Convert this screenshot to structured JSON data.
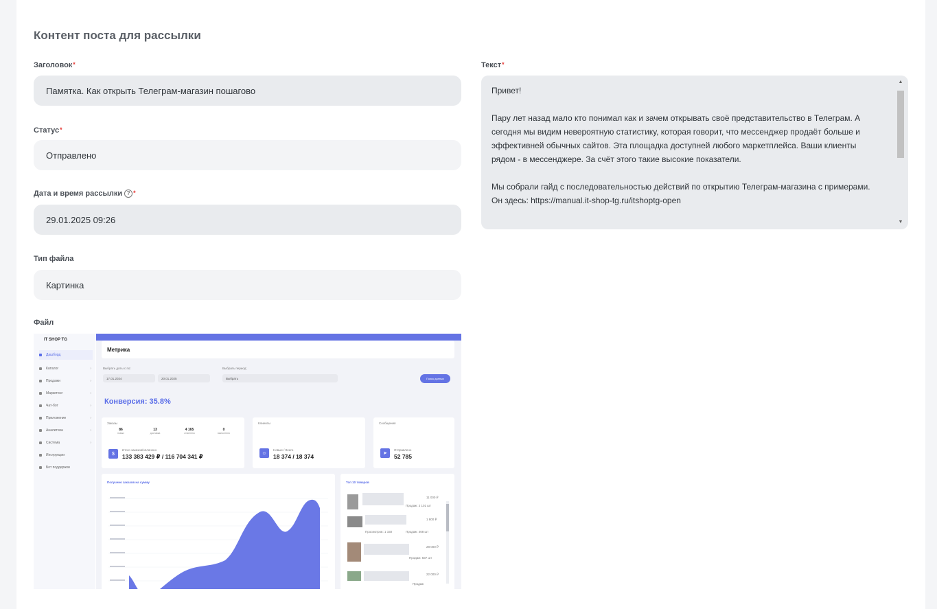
{
  "section_title": "Контент поста для рассылки",
  "fields": {
    "title": {
      "label": "Заголовок",
      "required": "*",
      "value": "Памятка. Как открыть Телеграм-магазин пошагово"
    },
    "status": {
      "label": "Статус",
      "required": "*",
      "value": "Отправлено"
    },
    "datetime": {
      "label": "Дата и время рассылки",
      "help": "?",
      "required": "*",
      "value": "29.01.2025 09:26"
    },
    "file_type": {
      "label": "Тип файла",
      "value": "Картинка"
    },
    "file": {
      "label": "Файл"
    },
    "text": {
      "label": "Текст",
      "required": "*",
      "paragraphs": [
        "Привет!",
        "Пару лет назад мало кто понимал как и зачем открывать своё представительство в Телеграм. А сегодня мы видим невероятную статистику, которая говорит, что мессенджер продаёт больше и эффективней обычных сайтов. Эта площадка доступней любого маркетплейса. Ваши клиенты рядом - в мессенджере. За счёт этого такие высокие показатели.",
        "Мы собрали гайд с последовательностью действий по открытию Телеграм-магазина с примерами. Он здесь: https://manual.it-shop-tg.ru/itshoptg-open"
      ]
    }
  },
  "preview": {
    "logo": "IT SHOP TG",
    "sidebar": [
      "Дашборд",
      "Каталог",
      "Продажи",
      "Маркетинг",
      "Чат-бот",
      "Приложение",
      "Аналитика",
      "Система",
      "Инструкции",
      "Бот поддержки"
    ],
    "page_title": "Метрика",
    "date_range_label": "Выбрать даты с по:",
    "date_from": "17.01.2024",
    "date_to": "20.01.2025",
    "period_label": "Выбрать период:",
    "period_value": "Выбрать",
    "apply_button": "Поиск данных",
    "conversion": "Конверсия: 35.8%",
    "orders_card": {
      "title": "Заказы",
      "stats": [
        {
          "value": "86",
          "label": "новых"
        },
        {
          "value": "13",
          "label": "доставка"
        },
        {
          "value": "4 165",
          "label": "отменено"
        },
        {
          "value": "0",
          "label": "выполнено"
        }
      ],
      "total_label": "Итого заказов/оплачено",
      "total": "133 383 429 ₽ / 116 704 341 ₽"
    },
    "clients_card": {
      "title": "Клиенты",
      "sub": "Новые / Всего",
      "value": "18 374 / 18 374"
    },
    "messages_card": {
      "title": "Сообщения",
      "sub": "Отправлено",
      "value": "52 785"
    },
    "chart_title": "Получено заказов на сумму",
    "top_title": "Топ 10 товаров",
    "top_rows": [
      {
        "price": "11 000 ₽",
        "sales": "Продаж: 2 101 шт"
      },
      {
        "price": "1 800 ₽",
        "views": "Просмотров: 1 192",
        "sales": "Продаж: 468 шт"
      },
      {
        "price": "28 000 ₽",
        "sales": "Продаж: 837 шт"
      },
      {
        "price": "22 000 ₽",
        "sales": "Продаж"
      }
    ]
  },
  "colors": {
    "accent": "#6473e4",
    "required": "#e53935"
  }
}
